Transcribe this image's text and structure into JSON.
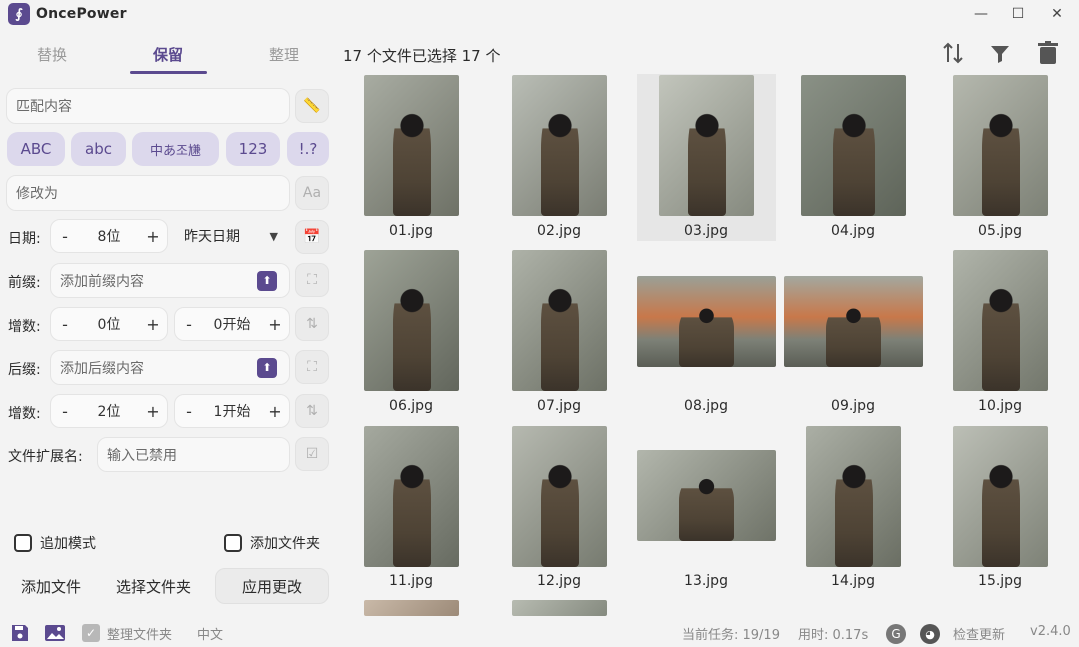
{
  "app": {
    "title": "OncePower",
    "version": "v2.4.0"
  },
  "window": {
    "minimize": "—",
    "maximize": "☐",
    "close": "✕"
  },
  "tabs": [
    {
      "label": "替换",
      "active": false
    },
    {
      "label": "保留",
      "active": true
    },
    {
      "label": "整理",
      "active": false
    }
  ],
  "header": {
    "selection": "17 个文件已选择 17 个"
  },
  "toolbar": {
    "sort_icon": "sort-icon",
    "filter_icon": "filter-icon",
    "delete_icon": "trash-icon"
  },
  "panel": {
    "match_placeholder": "匹配内容",
    "chips": [
      "ABC",
      "abc",
      "中あ조尲",
      "123",
      "!.?"
    ],
    "modify_placeholder": "修改为",
    "date": {
      "label": "日期:",
      "minus": "-",
      "value": "8位",
      "plus": "+",
      "option": "昨天日期"
    },
    "prefix": {
      "label": "前缀:",
      "placeholder": "添加前缀内容"
    },
    "inc1": {
      "label": "增数:",
      "minus": "-",
      "value": "0位",
      "plus": "+",
      "minus2": "-",
      "value2": "0开始",
      "plus2": "+"
    },
    "suffix": {
      "label": "后缀:",
      "placeholder": "添加后缀内容"
    },
    "inc2": {
      "label": "增数:",
      "minus": "-",
      "value": "2位",
      "plus": "+",
      "minus2": "-",
      "value2": "1开始",
      "plus2": "+"
    },
    "ext": {
      "label": "文件扩展名:",
      "placeholder": "输入已禁用"
    },
    "append_mode": "追加模式",
    "add_folder_check": "添加文件夹",
    "buttons": {
      "add_files": "添加文件",
      "select_folder": "选择文件夹",
      "apply": "应用更改"
    }
  },
  "footer": {
    "organize": "整理文件夹",
    "lang": "中文",
    "task": "当前任务: 19/19",
    "time": "用时: 0.17s",
    "update": "检查更新"
  },
  "files": [
    "01.jpg",
    "02.jpg",
    "03.jpg",
    "04.jpg",
    "05.jpg",
    "06.jpg",
    "07.jpg",
    "08.jpg",
    "09.jpg",
    "10.jpg",
    "11.jpg",
    "12.jpg",
    "13.jpg",
    "14.jpg",
    "15.jpg"
  ],
  "colors": {
    "accent": "#5b4a8f",
    "chip_bg": "#dcd8ec",
    "bg": "#f3f3f3"
  }
}
